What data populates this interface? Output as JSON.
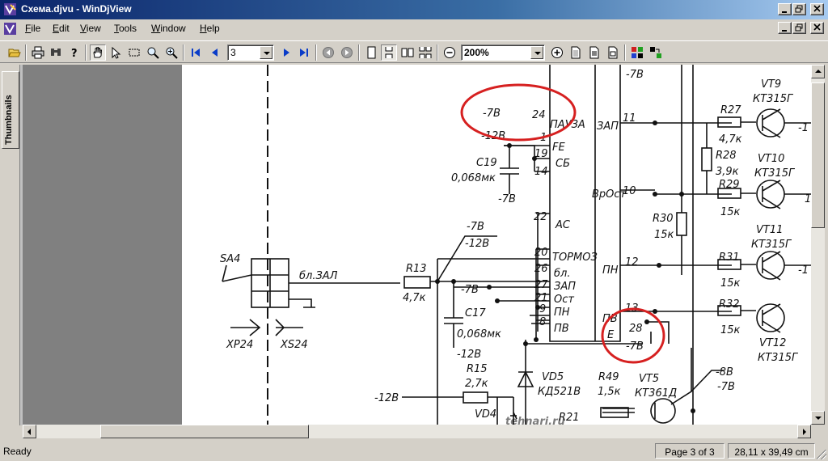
{
  "window": {
    "title": "Схема.djvu - WinDjView",
    "title_bar_color": "#0a246a"
  },
  "menu": {
    "items": [
      "File",
      "Edit",
      "View",
      "Tools",
      "Window",
      "Help"
    ]
  },
  "toolbar": {
    "page_number": "3",
    "zoom": "200%",
    "icons": [
      "open-icon",
      "print-icon",
      "find-icon",
      "help-icon",
      "hand-icon",
      "select-icon",
      "zoom-rect-icon",
      "zoom-icon",
      "magnify-icon",
      "first-page-icon",
      "prev-page-icon",
      "next-page-icon",
      "last-page-icon",
      "back-icon",
      "forward-icon",
      "single-page-icon",
      "continuous-icon",
      "facing-icon",
      "continuous-facing-icon",
      "zoom-out-icon",
      "zoom-in-icon",
      "page-icon",
      "page-icon-2",
      "page-icon-3",
      "color-mode-icon",
      "layout-icon"
    ]
  },
  "sidebar": {
    "tab_label": "Thumbnails"
  },
  "document": {
    "highlight_color": "#d62020",
    "watermark": "tehnari.ru",
    "labels": {
      "sa4": "SA4",
      "xp24": "XP24",
      "xs24": "XS24",
      "bl_zal": "бл.ЗАЛ",
      "r13": "R13",
      "r13_val": "4,7к",
      "c17": "C17",
      "c17_val": "0,068мк",
      "c19": "C19",
      "c19_val": "0,068мк",
      "r15": "R15",
      "r15_val": "2,7к",
      "vd4": "VD4",
      "vd5": "VD5",
      "vd5_type": "КД521В",
      "r49": "R49",
      "r49_val": "1,5к",
      "vt5": "VT5",
      "vt5_type": "КТ361Д",
      "r21": "R21",
      "r27": "R27",
      "r27_val": "4,7к",
      "r28": "R28",
      "r28_val": "3,9к",
      "r29": "R29",
      "r29_val": "15к",
      "r30": "R30",
      "r30_val": "15к",
      "r31": "R31",
      "r31_val": "15к",
      "r32": "R32",
      "r32_val": "15к",
      "vt9": "VT9",
      "vt10": "VT10",
      "vt11": "VT11",
      "vt12": "VT12",
      "kt315g": "КТ315Г",
      "minus7": "-7В",
      "minus12": "-12В",
      "minus8": "-8В",
      "pin24": "24",
      "pin28": "28",
      "pin1": "1",
      "pin19": "19",
      "pin14": "14",
      "pin22": "22",
      "pin20": "20",
      "pin26": "26",
      "pin27": "27",
      "pin21": "21",
      "pin9": "9",
      "pin8": "8",
      "pin11": "11",
      "pin10": "10",
      "pin12": "12",
      "pin13": "13",
      "fe": "FE",
      "sb": "СБ",
      "ac": "АС",
      "pauza": "ПАУЗА",
      "tormoz": "ТОРМОЗ",
      "bl": "бл.",
      "zap": "ЗАП",
      "ost": "Ост",
      "pn": "ПН",
      "pv": "ПВ",
      "zap_r": "ЗАП",
      "vrost": "ВрОст",
      "pn_r": "ПН",
      "pv_r": "ПВ",
      "e": "Е",
      "minus1": "-1",
      "unit1": "1"
    }
  },
  "status": {
    "ready": "Ready",
    "page_info": "Page 3 of 3",
    "page_size": "28,11 x 39,49 cm"
  }
}
